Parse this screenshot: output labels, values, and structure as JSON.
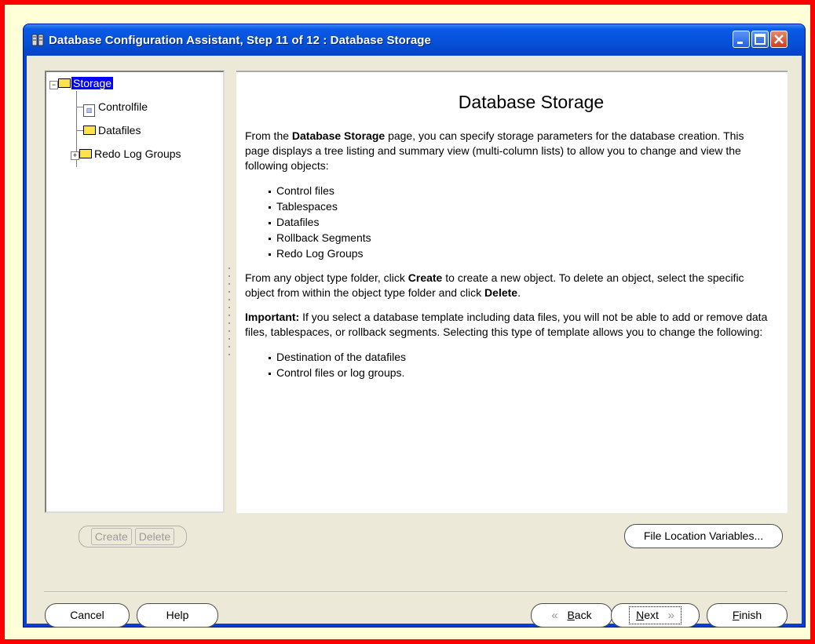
{
  "window": {
    "title": "Database Configuration Assistant, Step 11 of 12 : Database Storage",
    "icon": "database-icon"
  },
  "tree": {
    "items": [
      {
        "label": "Storage",
        "icon": "folder-icon",
        "expanded": true,
        "selected": true
      },
      {
        "label": "Controlfile",
        "icon": "controlfile-icon"
      },
      {
        "label": "Datafiles",
        "icon": "folder-icon"
      },
      {
        "label": "Redo Log Groups",
        "icon": "folder-icon",
        "expanded": false
      }
    ]
  },
  "content": {
    "title": "Database Storage",
    "intro_pre": "From the ",
    "intro_bold": "Database Storage",
    "intro_post": " page, you can specify storage parameters for the database creation. This page displays a tree listing and summary view (multi-column lists) to allow you to change and view the following objects:",
    "objects": [
      "Control files",
      "Tablespaces",
      "Datafiles",
      "Rollback Segments",
      "Redo Log Groups"
    ],
    "create_pre": "From any object type folder, click ",
    "create_bold": "Create",
    "create_mid": " to create a new object. To delete an object, select the specific object from within the object type folder and click ",
    "delete_bold": "Delete",
    "create_end": ".",
    "important_bold": "Important:",
    "important_text": " If you select a database template including data files, you will not be able to add or remove data files, tablespaces, or rollback segments. Selecting this type of template allows you to change the following:",
    "changeable": [
      "Destination of the datafiles",
      "Control files or log groups."
    ]
  },
  "buttons": {
    "create": "Create",
    "delete": "Delete",
    "file_location_variables": "File Location Variables...",
    "cancel": "Cancel",
    "help": "Help",
    "back_prefix": "",
    "back_underline": "B",
    "back_rest": "ack",
    "next_underline": "N",
    "next_rest": "ext",
    "finish_underline": "F",
    "finish_rest": "inish"
  },
  "colors": {
    "titlebar": "#0550d6",
    "selection": "#0000ff",
    "outer_border": "#ff0000",
    "outer_background": "#ffffd8",
    "dialog_background": "#ece9d8"
  }
}
